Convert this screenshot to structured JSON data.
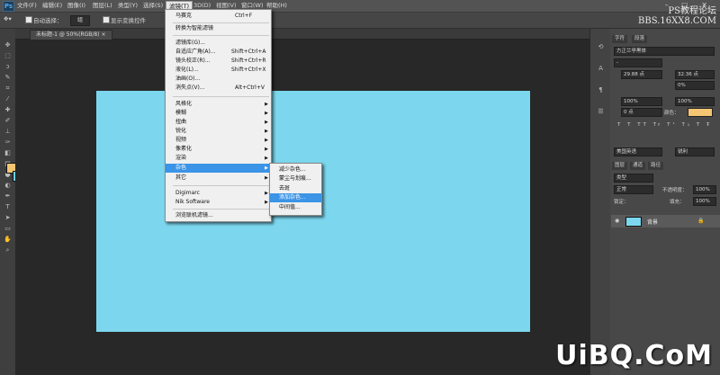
{
  "app": {
    "logo": "Ps"
  },
  "menubar": {
    "items": [
      "文件(F)",
      "编辑(E)",
      "图像(I)",
      "图层(L)",
      "类型(Y)",
      "选择(S)",
      "滤镜(T)",
      "3D(D)",
      "视图(V)",
      "窗口(W)",
      "帮助(H)"
    ],
    "active": "滤镜(T)",
    "window_controls": "– ▢ ✕"
  },
  "options": {
    "auto_select_label": "自动选择：",
    "auto_select_value": "组",
    "show_transform_label": "显示变换控件"
  },
  "watermark_top": {
    "line1": "PS教程论坛",
    "line2": "BBS.16XX8.COM"
  },
  "document": {
    "tab_title": "未标题-1 @ 50%(RGB/8) ×"
  },
  "filter_menu": {
    "top": [
      {
        "label": "马赛克",
        "shortcut": "Ctrl+F"
      },
      {
        "label": "转换为智能滤镜",
        "shortcut": ""
      }
    ],
    "group2": [
      {
        "label": "滤镜库(G)...",
        "shortcut": ""
      },
      {
        "label": "自适应广角(A)...",
        "shortcut": "Shift+Ctrl+A"
      },
      {
        "label": "镜头校正(R)...",
        "shortcut": "Shift+Ctrl+R"
      },
      {
        "label": "液化(L)...",
        "shortcut": "Shift+Ctrl+X"
      },
      {
        "label": "油画(O)...",
        "shortcut": ""
      },
      {
        "label": "消失点(V)...",
        "shortcut": "Alt+Ctrl+V"
      }
    ],
    "submenus": [
      "风格化",
      "模糊",
      "扭曲",
      "锐化",
      "视频",
      "像素化",
      "渲染",
      "杂色",
      "其它"
    ],
    "highlighted": "杂色",
    "plugins": [
      "Digimarc",
      "Nik Software"
    ],
    "browse": "浏览联机滤镜..."
  },
  "noise_submenu": {
    "items": [
      "减少杂色...",
      "蒙尘与划痕...",
      "去斑",
      "添加杂色...",
      "中间值..."
    ],
    "highlighted": "添加杂色..."
  },
  "right_panel": {
    "tabs": [
      "字符",
      "段落"
    ],
    "font_family": "方正兰亭黑体",
    "font_style": "-",
    "font_size": "29.88 点",
    "leading": "32.36 点",
    "tracking": "0%",
    "scale_v": "100%",
    "scale_h": "100%",
    "baseline": "0 点",
    "color_label": "颜色：",
    "lang": "美国英语",
    "aa": "锐利",
    "layers_tabs": [
      "图层",
      "通道",
      "路径"
    ],
    "kind": "类型",
    "blend": "正常",
    "opacity_label": "不透明度：",
    "opacity": "100%",
    "lock_label": "锁定：",
    "fill_label": "填充：",
    "fill": "100%",
    "layer_name": "背景"
  },
  "watermark_bottom": "UiBQ.CoM",
  "colors": {
    "canvas": "#7cd7ee",
    "foreground": "#f5c573",
    "background": "#6fd0ea",
    "highlight": "#3b94e6"
  }
}
